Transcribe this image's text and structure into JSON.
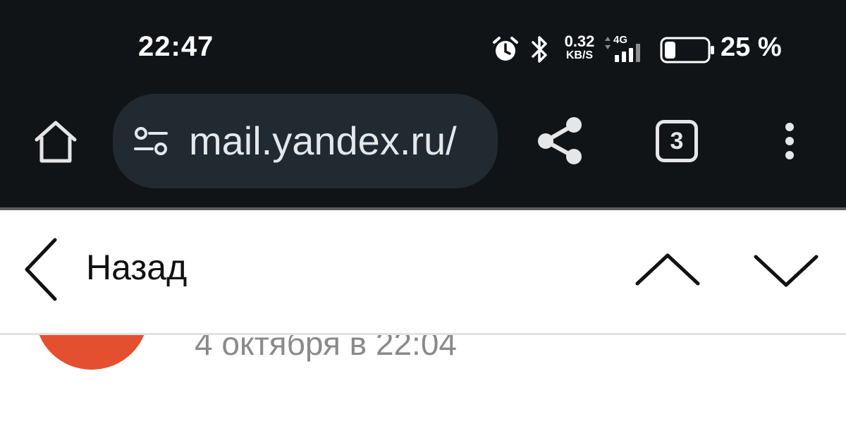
{
  "status_bar": {
    "time": "22:47",
    "net_speed_value": "0.32",
    "net_speed_unit": "KB/S",
    "network_type": "4G",
    "battery_percent": "25 %",
    "battery_level": 0.25,
    "icons": [
      "alarm-icon",
      "bluetooth-icon",
      "signal-icon",
      "battery-icon"
    ]
  },
  "browser": {
    "url": "mail.yandex.ru/",
    "tab_count": "3",
    "icons": [
      "home-icon",
      "site-settings-icon",
      "share-icon",
      "tabs-icon",
      "more-icon"
    ]
  },
  "mail_header": {
    "back_label": "Назад",
    "icons": [
      "back-chevron-icon",
      "previous-chevron-icon",
      "next-chevron-icon"
    ]
  },
  "message": {
    "date": "4 октября в 22:04",
    "avatar_color": "#e4502f"
  },
  "colors": {
    "topbar_bg": "#111417",
    "urlbar_bg": "#212a31",
    "text_light": "#ffffff"
  }
}
